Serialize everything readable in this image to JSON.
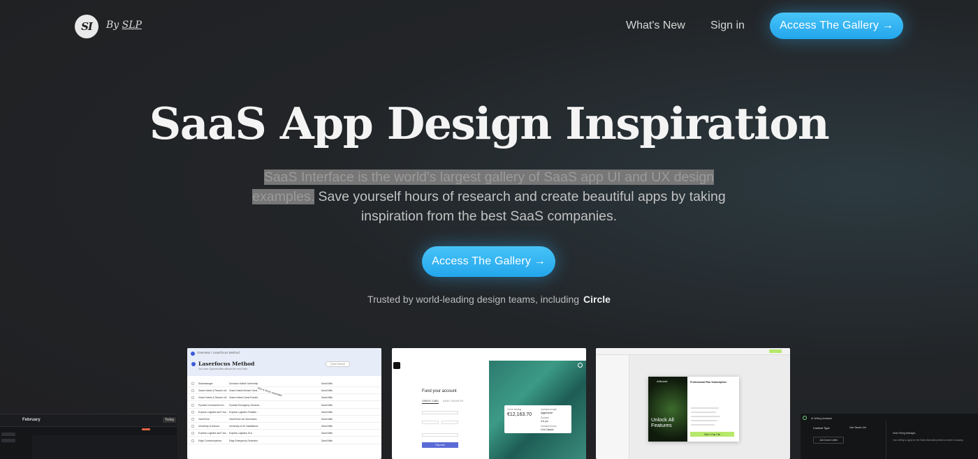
{
  "header": {
    "logo_mark": "SI",
    "logo_by": "By",
    "logo_author": "SLP",
    "nav": [
      "What's New",
      "Sign in"
    ],
    "cta": "Access The Gallery →"
  },
  "hero": {
    "title": "SaaS App Design Inspiration",
    "subtitle_highlight": "SaaS Interface is the world's largest gallery of SaaS app UI and UX design examples.",
    "subtitle_rest": " Save yourself hours of research and create beautiful apps by taking inspiration from the best SaaS companies.",
    "cta": "Access The Gallery →",
    "trusted_text": "Trusted by world-leading design teams, including",
    "trusted_brand": "Circle"
  },
  "gallery": {
    "card_left": {
      "month": "February",
      "today": "Today"
    },
    "card1": {
      "breadcrumb": "Overview  /  Laserfocus Method",
      "title": "Laserfocus Method",
      "subtitle": "You have Opportunities without the next Task.",
      "search": "Quick Search",
      "rows": [
        {
          "account": "Shabmanager",
          "opp": "Dominion Mobile Ownership",
          "owner": "David Mills"
        },
        {
          "account": "Grand Hotels & Resorts Ltd",
          "opp": "Grand Hotels Kitchen Gene...",
          "owner": "David Mills"
        },
        {
          "account": "Grand Hotels & Resorts Ltd",
          "opp": "Grand Hotels Guest Portabl...",
          "owner": "David Mills"
        },
        {
          "account": "Pyramid Construction Inc.",
          "opp": "Pyramid Emergency Generat...",
          "owner": "David Mills"
        },
        {
          "account": "Express Logistics and Tran...",
          "opp": "Express Logistics Portable...",
          "owner": "David Mills"
        },
        {
          "account": "GenePoint",
          "opp": "GenePoint Lab Generators",
          "owner": "David Mills"
        },
        {
          "account": "University of Arizona",
          "opp": "University of AZ Installations",
          "owner": "David Mills"
        },
        {
          "account": "Express Logistics and Tran...",
          "opp": "Express Logistics SLA",
          "owner": "David Mills"
        },
        {
          "account": "Edge Communications",
          "opp": "Edge Emergency Generator",
          "owner": "David Mills"
        }
      ],
      "note": "Got a fresh reminder"
    },
    "card2": {
      "title": "Fund your account",
      "tab1": "CREDIT CARD",
      "tab2": "BANK TRANSFER",
      "amount_label": "You're funding",
      "amount": "€12,163.70",
      "style_label": "Investment style",
      "style": "Aggressive",
      "duration_label": "Duration",
      "duration": "3-5 yrs",
      "plan_label": "Investment plan",
      "plan": "Cris Classic",
      "button": "Pay now"
    },
    "card3": {
      "brand": "Artboard",
      "headline": "Unlock All Features",
      "plan_title": "Professional Plan Subscription",
      "button": "Start 7-Day Trial"
    },
    "card_right": {
      "title": "AI Writing Assistant",
      "content_type": "Content Type",
      "item": "Job Cover Letter",
      "saved": "Use Saved Job",
      "greeting": "Dear Hiring Manager,",
      "body": "I am writing to apply for the Sales Specialist position at Acme Company."
    }
  }
}
